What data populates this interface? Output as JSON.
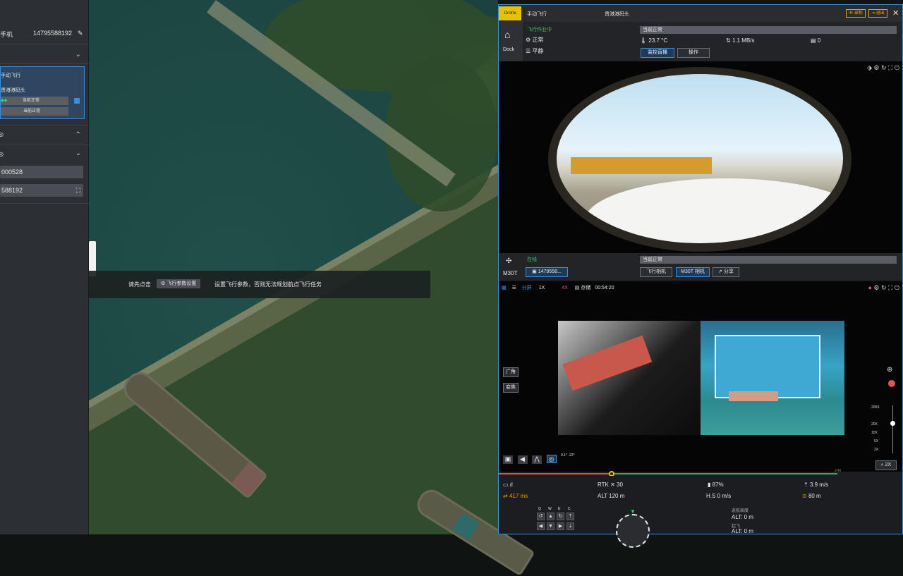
{
  "left": {
    "phone_label": "手机",
    "phone_number": "14795588192",
    "selected_mode": "手动飞行",
    "selected_site": "贵港港码头",
    "status_a": "当前正常",
    "status_b": "当前正常",
    "field1": "000528",
    "field2": "588192"
  },
  "map": {
    "toast_prefix": "请先点击",
    "toast_button": "飞行参数设置",
    "toast_suffix": "设置飞行参数，否则无法规划航点飞行任务"
  },
  "dock": {
    "badge": "Online",
    "mode": "手动飞行",
    "site": "贵港港码头",
    "btn_record": "录制",
    "btn_exit": "退出",
    "dock_label": "Dock",
    "status_line": "飞行作业中",
    "normal": "正常",
    "flat": "平静",
    "status_bar": "当前正常",
    "temp": "23.7 °C",
    "speed": "1.1 MB/s",
    "count": "0",
    "tab_live": "监控直播",
    "tab_ops": "操作"
  },
  "drone": {
    "label": "M30T",
    "status": "在线",
    "status_bar": "当前正常",
    "serial": "1479558...",
    "btn_flight_cam": "飞行相机",
    "btn_m30t_cam": "M30T 相机",
    "btn_share": "分享",
    "toolbar_mode": "分屏",
    "toolbar_a": "1X",
    "toolbar_b": "4X",
    "storage": "存储",
    "duration": "00:54:20",
    "side_btn1": "广角",
    "side_btn2": "变焦",
    "zoom_levels": [
      "200X",
      "20X",
      "10X",
      "5X",
      "2X"
    ],
    "zoom_badge": "2X",
    "gimbal": "0.1° -22°",
    "timeline_end": "2'40"
  },
  "telemetry": {
    "rtk": "RTK",
    "rtk_value": "30",
    "battery": "87%",
    "vspeed": "3.9 m/s",
    "latency": "417 ms",
    "alt": "ALT 120 m",
    "hs": "H.S 0 m/s",
    "dist": "80 m",
    "home_label": "返航高度",
    "home_alt": "ALT: 0 m",
    "takeoff_label": "起飞",
    "takeoff_alt": "ALT: 0 m",
    "keys": [
      "Q",
      "W",
      "E",
      "C"
    ]
  }
}
